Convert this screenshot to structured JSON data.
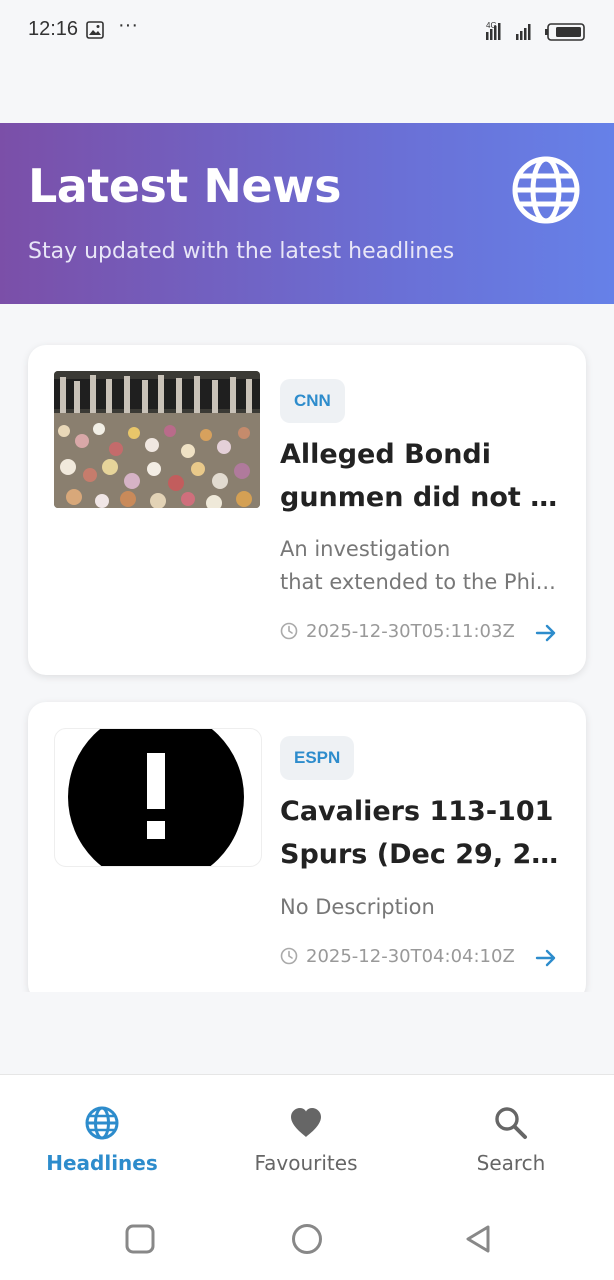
{
  "status_bar": {
    "time": "12:16",
    "more": "···",
    "network": "4G"
  },
  "header": {
    "title": "Latest News",
    "subtitle": "Stay updated with the latest headlines"
  },
  "articles": [
    {
      "source": "CNN",
      "title_line1": "Alleged Bondi",
      "title_line2": "gunmen did not tr...",
      "desc_line1": "An investigation",
      "desc_line2": "that extended to the Phi...",
      "timestamp": "2025-12-30T05:11:03Z"
    },
    {
      "source": "ESPN",
      "title_line1": "Cavaliers 113-101",
      "title_line2": "Spurs (Dec 29, 202...",
      "desc_line1": "No Description",
      "timestamp": "2025-12-30T04:04:10Z"
    }
  ],
  "bottom_nav": {
    "items": [
      {
        "label": "Headlines",
        "icon": "globe-icon",
        "active": true
      },
      {
        "label": "Favourites",
        "icon": "heart-icon",
        "active": false
      },
      {
        "label": "Search",
        "icon": "search-icon",
        "active": false
      }
    ]
  },
  "colors": {
    "accent": "#2d8ccc",
    "header_start": "#7b4fa8",
    "header_end": "#6681e8",
    "inactive": "#666666"
  }
}
